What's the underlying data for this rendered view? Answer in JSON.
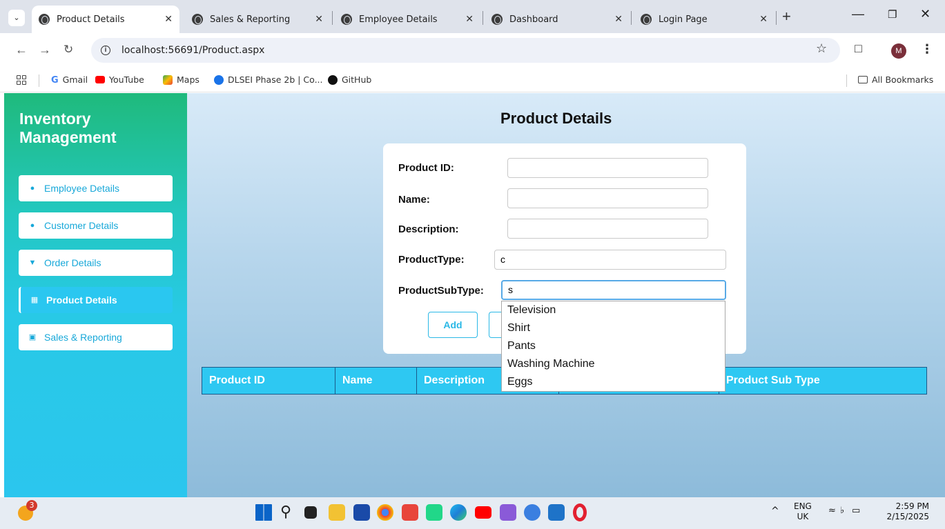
{
  "browser": {
    "tabs": [
      {
        "label": "Product Details",
        "active": true
      },
      {
        "label": "Sales & Reporting"
      },
      {
        "label": "Employee Details"
      },
      {
        "label": "Dashboard"
      },
      {
        "label": "Login Page"
      }
    ],
    "url": "localhost:56691/Product.aspx",
    "avatar_letter": "M",
    "bookmarks": [
      "Gmail",
      "YouTube",
      "Maps",
      "DLSEI Phase 2b | Co...",
      "GitHub"
    ],
    "all_bookmarks": "All Bookmarks"
  },
  "sidebar": {
    "brand": "Inventory Management",
    "items": [
      {
        "label": "Employee Details",
        "icon": "user-icon"
      },
      {
        "label": "Customer Details",
        "icon": "users-icon"
      },
      {
        "label": "Order Details",
        "icon": "cart-icon"
      },
      {
        "label": "Product Details",
        "icon": "archive-icon",
        "active": true
      },
      {
        "label": "Sales & Reporting",
        "icon": "chart-icon"
      }
    ]
  },
  "main": {
    "title": "Product Details",
    "form": {
      "product_id_label": "Product ID:",
      "product_id_value": "",
      "name_label": "Name:",
      "name_value": "",
      "description_label": "Description:",
      "description_value": "",
      "product_type_label": "ProductType:",
      "product_type_value": "c",
      "product_subtype_label": "ProductSubType:",
      "product_subtype_value": "s",
      "add_label": "Add"
    },
    "autocomplete": [
      "Television",
      "Shirt",
      "Pants",
      "Washing Machine",
      "Eggs"
    ],
    "grid_headers": [
      "Product ID",
      "Name",
      "Description",
      "",
      "Product Sub Type"
    ]
  },
  "taskbar": {
    "notification_count": "3",
    "lang": "ENG",
    "region": "UK",
    "time": "2:59 PM",
    "date": "2/15/2025"
  }
}
